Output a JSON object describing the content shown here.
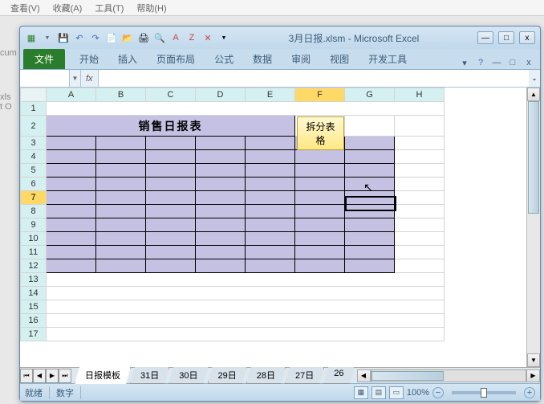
{
  "bg_menu": {
    "items": [
      "查看(V)",
      "收藏(A)",
      "工具(T)",
      "帮助(H)"
    ]
  },
  "bg_side": {
    "line1": "cum",
    "line2": "xls",
    "line3": "t O"
  },
  "window": {
    "title": "3月日报.xlsm - Microsoft Excel",
    "min": "—",
    "max": "□",
    "close": "x"
  },
  "ribbon": {
    "file": "文件",
    "tabs": [
      "开始",
      "插入",
      "页面布局",
      "公式",
      "数据",
      "审阅",
      "视图",
      "开发工具"
    ],
    "help_dd": "▾"
  },
  "formula": {
    "name_box": "",
    "fx": "fx",
    "value": ""
  },
  "columns": [
    "A",
    "B",
    "C",
    "D",
    "E",
    "F",
    "G",
    "H"
  ],
  "rows": [
    "1",
    "2",
    "3",
    "4",
    "5",
    "6",
    "7",
    "8",
    "9",
    "10",
    "11",
    "12",
    "13",
    "14",
    "15",
    "16",
    "17"
  ],
  "active_col": "F",
  "active_row": "7",
  "sheet": {
    "title": "销售日报表",
    "button": "拆分表格"
  },
  "sheet_tabs": {
    "active": "日报模板",
    "others": [
      "31日",
      "30日",
      "29日",
      "28日",
      "27日",
      "26"
    ]
  },
  "status": {
    "ready": "就绪",
    "num": "数字",
    "zoom": "100%",
    "minus": "−",
    "plus": "+"
  },
  "qat_icons": [
    "excel-icon",
    "save-icon",
    "undo-icon",
    "redo-icon",
    "new-icon",
    "open-icon",
    "print-icon",
    "preview-icon",
    "spell-icon",
    "sort-icon",
    "sort2-icon",
    "filter-icon",
    "delete-icon"
  ]
}
